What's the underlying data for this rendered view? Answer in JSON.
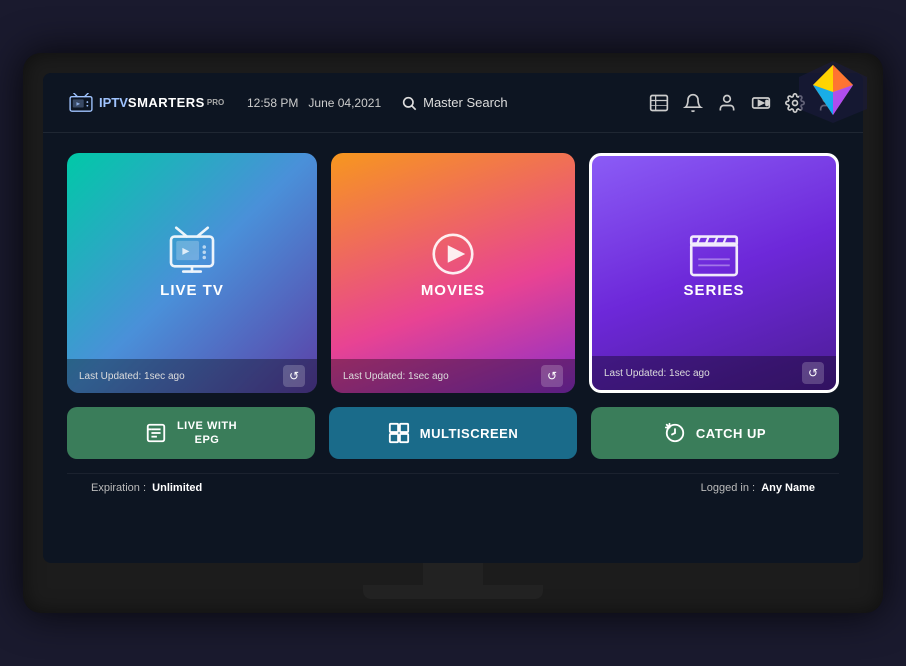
{
  "header": {
    "logo_iptv": "IPTV",
    "logo_smarters": "SMARTERS",
    "logo_pro": "PRO",
    "time": "12:58 PM",
    "date": "June 04,2021",
    "search_label": "Master Search"
  },
  "icons": {
    "search": "search-icon",
    "tv_guide": "tv-guide-icon",
    "bell": "bell-icon",
    "user": "user-icon",
    "record": "record-icon",
    "settings": "settings-icon",
    "add_user": "add-user-icon",
    "refresh": "refresh-icon"
  },
  "cards": [
    {
      "id": "live-tv",
      "title": "LIVE TV",
      "last_updated": "Last Updated: 1sec ago"
    },
    {
      "id": "movies",
      "title": "MOVIES",
      "last_updated": "Last Updated: 1sec ago"
    },
    {
      "id": "series",
      "title": "SERIES",
      "last_updated": "Last Updated: 1sec ago"
    }
  ],
  "action_buttons": [
    {
      "id": "live-epg",
      "label": "LIVE WITH\nEPG"
    },
    {
      "id": "multiscreen",
      "label": "MULTISCREEN"
    },
    {
      "id": "catchup",
      "label": "CATCH UP"
    }
  ],
  "footer": {
    "expiration_label": "Expiration :",
    "expiration_value": "Unlimited",
    "loggedin_label": "Logged in :",
    "loggedin_value": "Any Name"
  }
}
